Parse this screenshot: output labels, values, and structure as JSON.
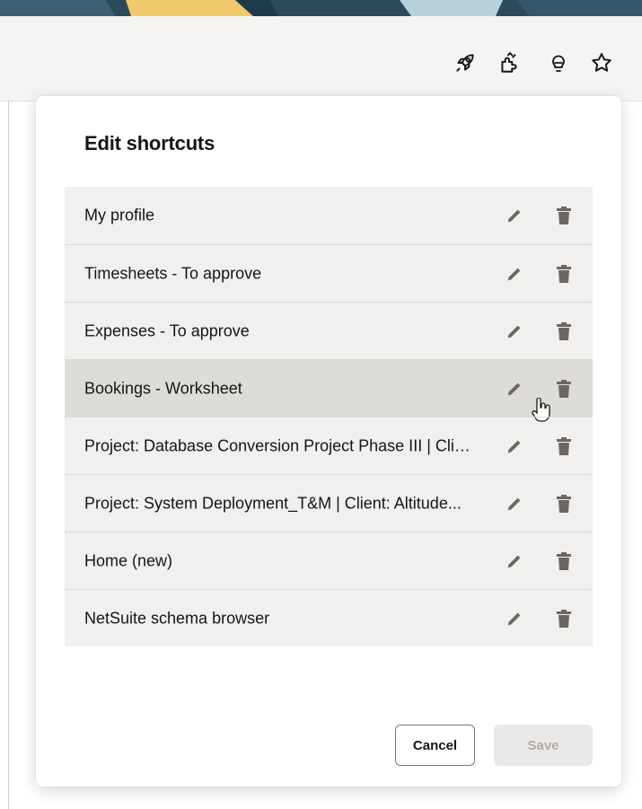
{
  "dialog": {
    "title": "Edit shortcuts",
    "cancel_label": "Cancel",
    "save_label": "Save"
  },
  "shortcuts": [
    {
      "label": "My profile"
    },
    {
      "label": "Timesheets - To approve"
    },
    {
      "label": "Expenses - To approve"
    },
    {
      "label": "Bookings - Worksheet"
    },
    {
      "label": "Project: Database Conversion Project Phase III | Client: ..."
    },
    {
      "label": "Project: System Deployment_T&M | Client: Altitude..."
    },
    {
      "label": "Home (new)"
    },
    {
      "label": "NetSuite schema browser"
    }
  ],
  "header_icons": [
    "rocket-icon",
    "puzzle-icon",
    "lightbulb-icon",
    "star-icon"
  ],
  "colors": {
    "banner_navy": "#2c4a5c",
    "banner_yellow": "#f1c86b",
    "banner_lightblue": "#b7d2dc",
    "header_bg": "#f5f4f2",
    "list_bg": "#f1f0ef",
    "hover_row": "#dedcd9",
    "icon_gray": "#6b6864"
  }
}
